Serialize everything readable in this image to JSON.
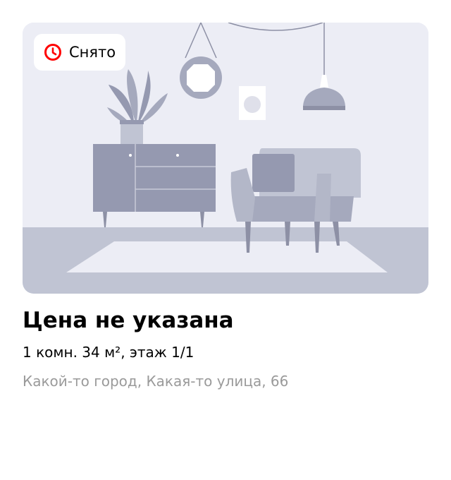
{
  "listing": {
    "status_badge": {
      "label": "Снято",
      "icon": "clock-icon",
      "icon_color": "#ff0000"
    },
    "image": {
      "kind": "placeholder-illustration",
      "subject": "living room interior"
    },
    "price": "Цена не указана",
    "details": "1 комн. 34 м², этаж 1/1",
    "address": "Какой-то город, Какая-то улица, 66"
  },
  "colors": {
    "background": "#ffffff",
    "illustration_wall": "#ecedf5",
    "illustration_floor": "#c0c4d3",
    "illustration_furniture": "#9599b0",
    "address_text": "#9a9a9a",
    "badge_accent": "#ff0000"
  }
}
